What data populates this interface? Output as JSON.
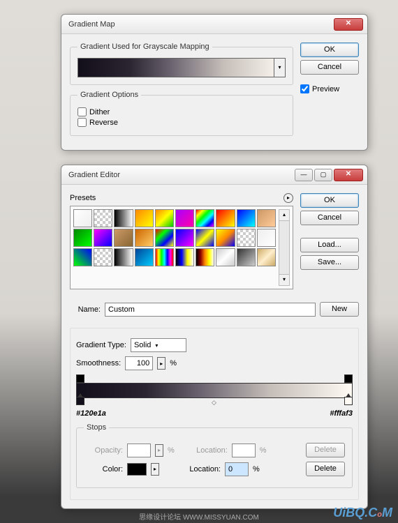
{
  "gradientMap": {
    "title": "Gradient Map",
    "groupGradient": "Gradient Used for Grayscale Mapping",
    "groupOptions": "Gradient Options",
    "dither": "Dither",
    "reverse": "Reverse",
    "ok": "OK",
    "cancel": "Cancel",
    "preview": "Preview"
  },
  "gradientEditor": {
    "title": "Gradient Editor",
    "presetsLabel": "Presets",
    "ok": "OK",
    "cancel": "Cancel",
    "load": "Load...",
    "save": "Save...",
    "nameLabel": "Name:",
    "nameValue": "Custom",
    "new": "New",
    "gradientTypeLabel": "Gradient Type:",
    "gradientTypeValue": "Solid",
    "smoothnessLabel": "Smoothness:",
    "smoothnessValue": "100",
    "percent": "%",
    "leftHex": "#120e1a",
    "rightHex": "#fffaf3",
    "stops": {
      "legend": "Stops",
      "opacityLabel": "Opacity:",
      "locationLabel": "Location:",
      "colorLabel": "Color:",
      "locationValue": "0",
      "delete": "Delete"
    }
  },
  "colors": {
    "start": "#120e1a",
    "end": "#fffaf3"
  },
  "watermark": "UiBQ.CoM",
  "footerText": "思缘设计论坛 WWW.MISSYUAN.COM"
}
